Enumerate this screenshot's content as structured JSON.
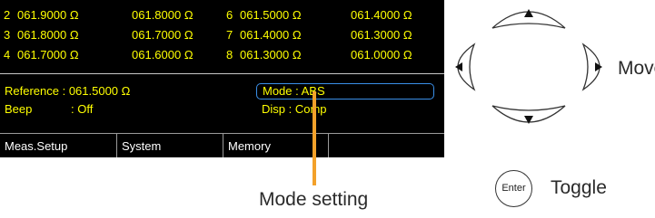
{
  "readings": [
    {
      "n1": "2",
      "v1": "061.9000 Ω",
      "v2": "061.8000 Ω",
      "n2": "6",
      "v3": "061.5000 Ω",
      "v4": "061.4000 Ω"
    },
    {
      "n1": "3",
      "v1": "061.8000 Ω",
      "v2": "061.7000 Ω",
      "n2": "7",
      "v3": "061.4000 Ω",
      "v4": "061.3000 Ω"
    },
    {
      "n1": "4",
      "v1": "061.7000 Ω",
      "v2": "061.6000 Ω",
      "n2": "8",
      "v3": "061.3000 Ω",
      "v4": "061.0000 Ω"
    }
  ],
  "status": {
    "reference": "Reference : 061.5000 Ω",
    "mode": "Mode : ABS",
    "beep_label": "Beep",
    "beep_value": ": Off",
    "disp": "Disp  : Comp"
  },
  "menu": {
    "meas_setup": "Meas.Setup",
    "system": "System",
    "memory": "Memory"
  },
  "annotations": {
    "mode_setting": "Mode setting",
    "move": "Move",
    "toggle": "Toggle",
    "enter": "Enter"
  },
  "colors": {
    "screen_bg": "#000000",
    "text_yellow": "#ffff00",
    "mode_highlight": "#3a8fe8",
    "pointer": "#f3a12a"
  },
  "icons": [
    "up-arrow-icon",
    "down-arrow-icon",
    "left-arrow-icon",
    "right-arrow-icon"
  ]
}
